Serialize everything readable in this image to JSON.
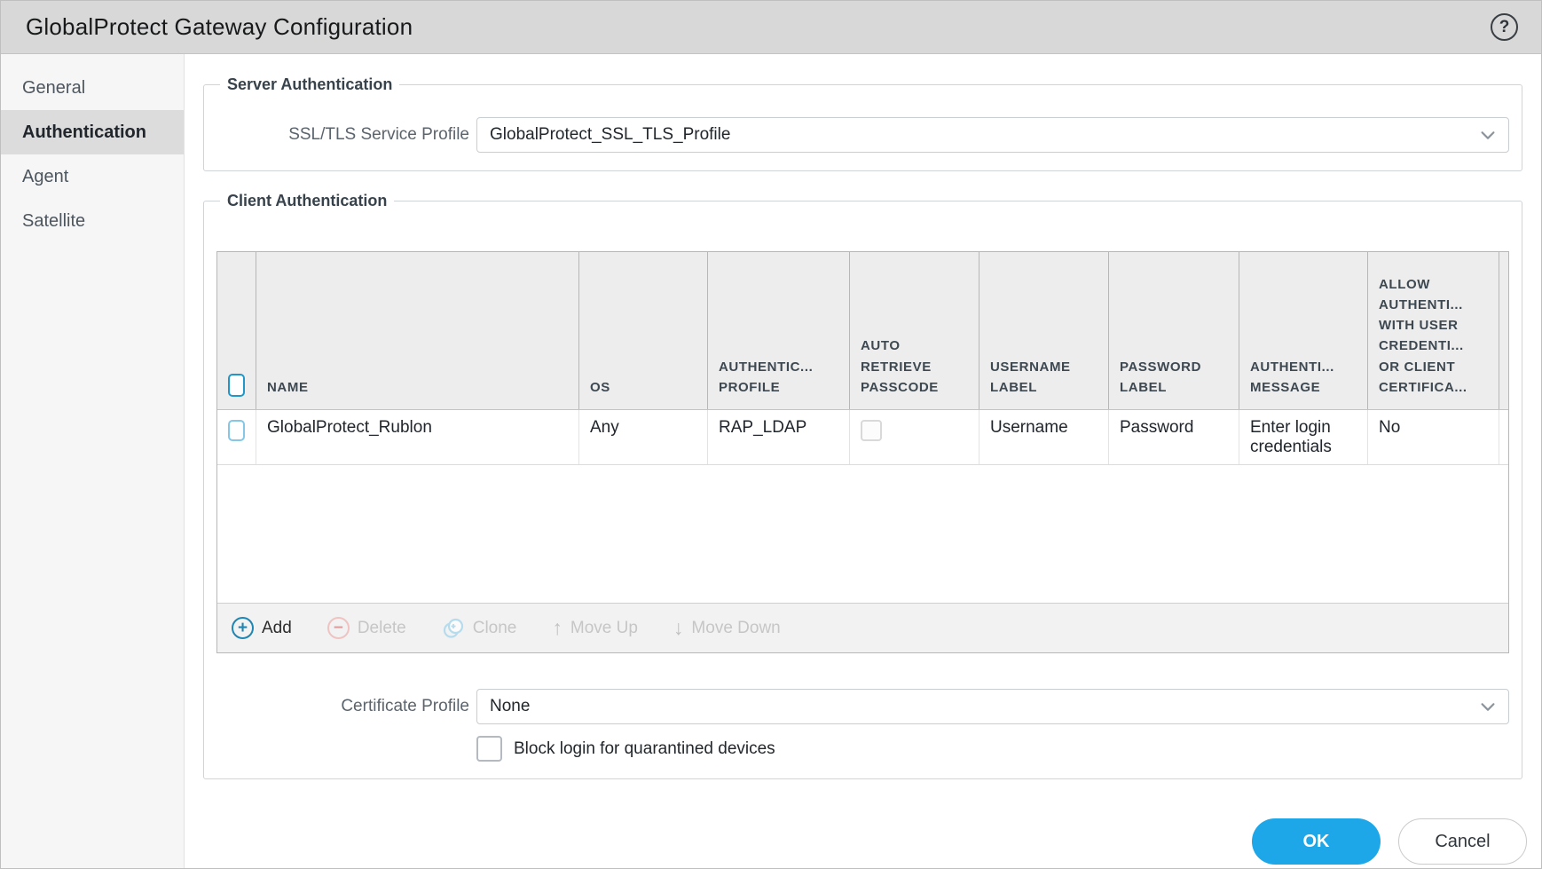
{
  "window": {
    "title": "GlobalProtect Gateway Configuration"
  },
  "sidebar": {
    "items": [
      {
        "label": "General",
        "selected": false
      },
      {
        "label": "Authentication",
        "selected": true
      },
      {
        "label": "Agent",
        "selected": false
      },
      {
        "label": "Satellite",
        "selected": false
      }
    ]
  },
  "server_authentication": {
    "legend": "Server Authentication",
    "ssl_tls_label": "SSL/TLS Service Profile",
    "ssl_tls_value": "GlobalProtect_SSL_TLS_Profile"
  },
  "client_authentication": {
    "legend": "Client Authentication",
    "table": {
      "columns": [
        "NAME",
        "OS",
        "AUTHENTIC... PROFILE",
        "AUTO RETRIEVE PASSCODE",
        "USERNAME LABEL",
        "PASSWORD LABEL",
        "AUTHENTI... MESSAGE",
        "ALLOW AUTHENTI... WITH USER CREDENTI... OR CLIENT CERTIFICA..."
      ],
      "rows": [
        {
          "selected": false,
          "name": "GlobalProtect_Rublon",
          "os": "Any",
          "authentication_profile": "RAP_LDAP",
          "auto_retrieve_passcode": false,
          "username_label": "Username",
          "password_label": "Password",
          "authentication_message": "Enter login credentials",
          "allow_auth_with_user_credentials_or_client_cert": "No"
        }
      ]
    },
    "toolbar": {
      "add": "Add",
      "delete": "Delete",
      "clone": "Clone",
      "move_up": "Move Up",
      "move_down": "Move Down"
    },
    "certificate_profile_label": "Certificate Profile",
    "certificate_profile_value": "None",
    "block_login_label": "Block login for quarantined devices",
    "block_login_checked": false
  },
  "footer": {
    "ok": "OK",
    "cancel": "Cancel"
  },
  "icons": {
    "help": "?",
    "add": "+",
    "delete": "−",
    "move_up": "↑",
    "move_down": "↓"
  },
  "colors": {
    "titlebar_bg": "#d8d8d8",
    "accent_blue": "#1da7e8",
    "selected_nav_bg": "#dcdcdc",
    "table_header_bg": "#ededed",
    "toolbar_bg": "#f2f2f2",
    "add_icon_blue": "#1f86b4",
    "delete_icon_red": "#e39c9c",
    "clone_icon_blue": "#b5dcee",
    "select_all_checkbox_blue": "#2196c9",
    "row_checkbox_blue": "#86c6e6"
  }
}
